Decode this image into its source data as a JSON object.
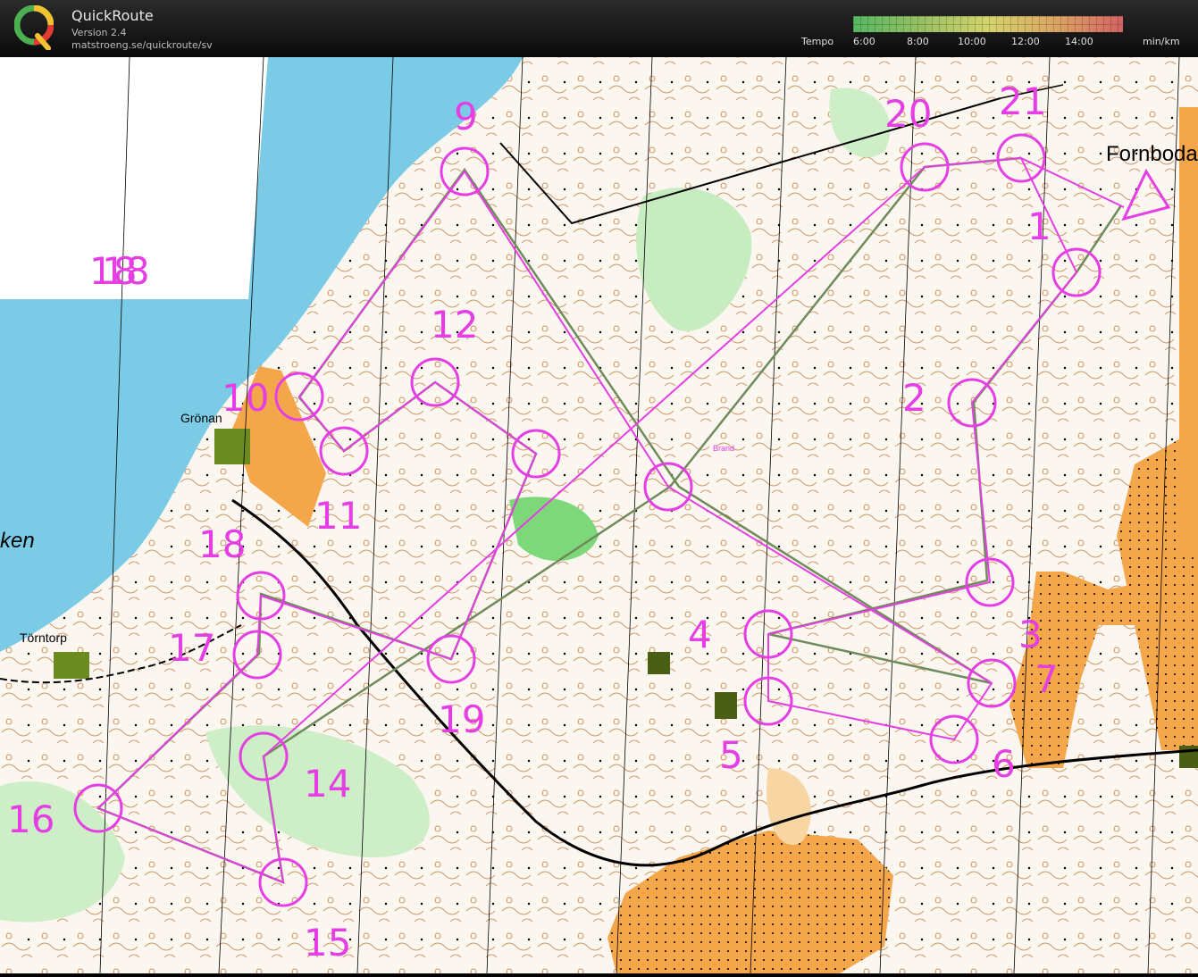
{
  "app": {
    "name": "QuickRoute",
    "version": "Version 2.4",
    "url": "matstroeng.se/quickroute/sv"
  },
  "tempo": {
    "label": "Tempo",
    "ticks": [
      "6:00",
      "8:00",
      "10:00",
      "12:00",
      "14:00"
    ],
    "unit": "min/km"
  },
  "colors": {
    "course": "#e43ee4",
    "route": "#6f8b5c",
    "water": "#7ccbe6",
    "open": "#f5a94a",
    "green": "#8fd686",
    "contour": "#b86a2c"
  },
  "map": {
    "place_names": [
      "Grönan",
      "Törntorp",
      "Fornboda",
      "ken",
      "Brand"
    ],
    "control_numbers": [
      "1",
      "2",
      "3",
      "4",
      "5",
      "6",
      "7",
      "9",
      "10",
      "11",
      "12",
      "14",
      "15",
      "16",
      "17",
      "18",
      "19",
      "20",
      "21",
      "18"
    ],
    "extra_label": "18"
  }
}
